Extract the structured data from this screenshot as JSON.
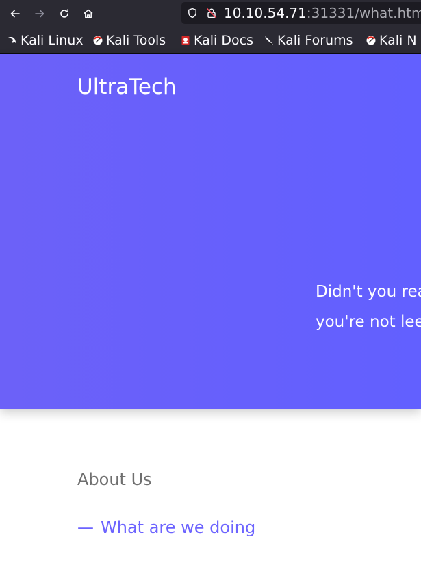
{
  "browser": {
    "url_host": "10.10.54.71",
    "url_rest": ":31331/what.htm",
    "icons": {
      "back": "arrow-left-icon",
      "forward": "arrow-right-icon",
      "reload": "reload-icon",
      "home": "home-icon",
      "shield": "shield-icon",
      "lock": "insecure-lock-icon"
    },
    "bookmarks": [
      {
        "label": "Kali Linux",
        "icon": "kali-dragon-icon"
      },
      {
        "label": "Kali Tools",
        "icon": "kali-tools-icon"
      },
      {
        "label": "Kali Docs",
        "icon": "kali-docs-icon"
      },
      {
        "label": "Kali Forums",
        "icon": "kali-forums-icon"
      },
      {
        "label": "Kali N",
        "icon": "kali-nethunter-icon"
      }
    ]
  },
  "page": {
    "brand": "UltraTech",
    "hero_line_1": "Didn't you rea",
    "hero_line_2": "you're not leet",
    "about_label": "About Us",
    "link_dash": "—",
    "link_label": "What are we doing",
    "colors": {
      "hero": "#6660fc",
      "link": "#6c63ff",
      "about": "#6f6f6f",
      "chrome": "#2b2a33"
    }
  }
}
